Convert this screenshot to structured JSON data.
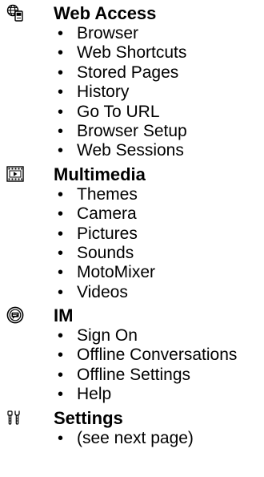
{
  "sections": [
    {
      "title": "Web Access",
      "icon": "globe-phone-icon",
      "items": [
        "Browser",
        "Web Shortcuts",
        "Stored Pages",
        "History",
        "Go To URL",
        "Browser Setup",
        "Web Sessions"
      ]
    },
    {
      "title": "Multimedia",
      "icon": "film-strip-icon",
      "items": [
        "Themes",
        "Camera",
        "Pictures",
        "Sounds",
        "MotoMixer",
        "Videos"
      ]
    },
    {
      "title": "IM",
      "icon": "im-chat-icon",
      "items": [
        "Sign On",
        "Offline Conversations",
        "Offline Settings",
        "Help"
      ]
    },
    {
      "title": "Settings",
      "icon": "tools-icon",
      "items": [
        "(see next page)"
      ]
    }
  ]
}
